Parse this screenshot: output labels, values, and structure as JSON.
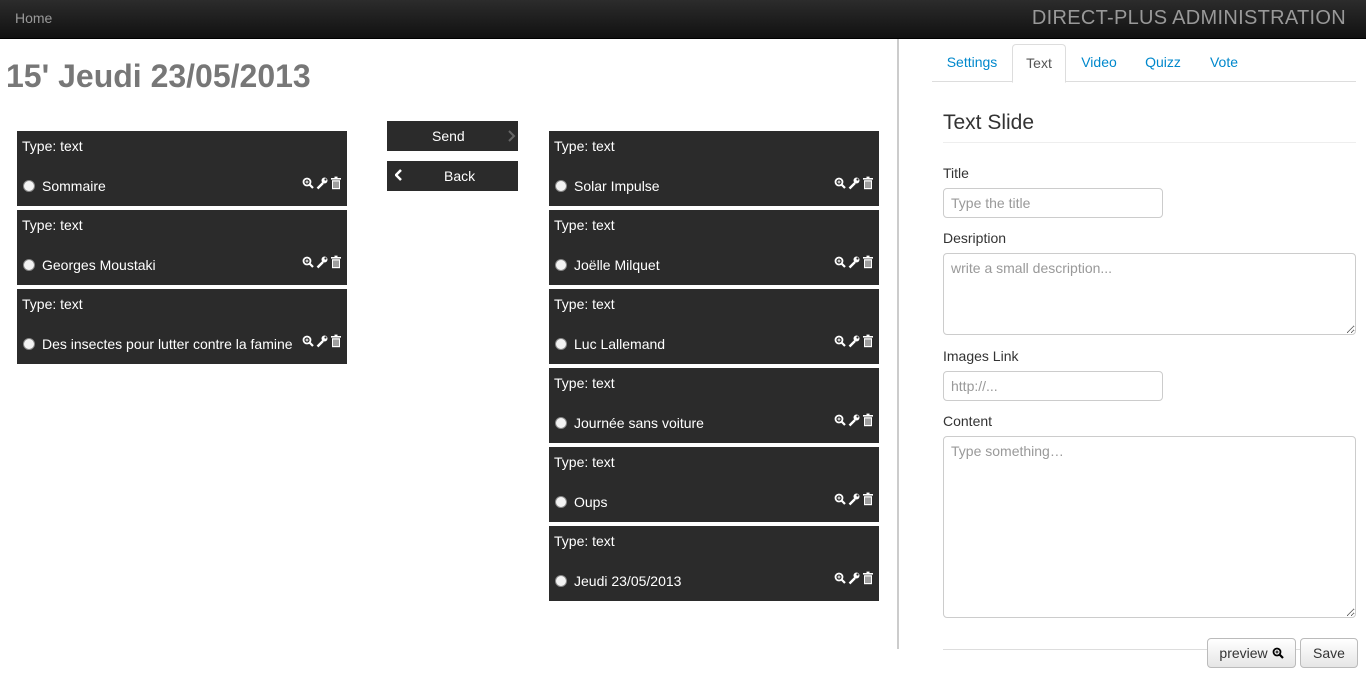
{
  "navbar": {
    "home": "Home",
    "brand": "DIRECT-PLUS ADMINISTRATION"
  },
  "page_title": "15' Jeudi 23/05/2013",
  "left_list": [
    {
      "type": "Type: text",
      "title": "Sommaire"
    },
    {
      "type": "Type: text",
      "title": "Georges Moustaki"
    },
    {
      "type": "Type: text",
      "title": "Des insectes pour lutter contre la famine"
    }
  ],
  "right_list": [
    {
      "type": "Type: text",
      "title": "Solar Impulse"
    },
    {
      "type": "Type: text",
      "title": "Joëlle Milquet"
    },
    {
      "type": "Type: text",
      "title": "Luc Lallemand"
    },
    {
      "type": "Type: text",
      "title": "Journée sans voiture"
    },
    {
      "type": "Type: text",
      "title": "Oups"
    },
    {
      "type": "Type: text",
      "title": "Jeudi 23/05/2013"
    }
  ],
  "actions": {
    "send": "Send",
    "back": "Back"
  },
  "tabs": [
    {
      "label": "Settings",
      "active": false
    },
    {
      "label": "Text",
      "active": true
    },
    {
      "label": "Video",
      "active": false
    },
    {
      "label": "Quizz",
      "active": false
    },
    {
      "label": "Vote",
      "active": false
    }
  ],
  "form": {
    "heading": "Text Slide",
    "title_label": "Title",
    "title_placeholder": "Type the title",
    "description_label": "Desription",
    "description_placeholder": "write a small description...",
    "images_label": "Images Link",
    "images_placeholder": "http://...",
    "content_label": "Content",
    "content_placeholder": "Type something…"
  },
  "buttons": {
    "preview": "preview",
    "save": "Save"
  },
  "colors": {
    "item_bg": "#2b2b2b",
    "link": "#0088cc",
    "navbar": "#1b1b1b"
  }
}
